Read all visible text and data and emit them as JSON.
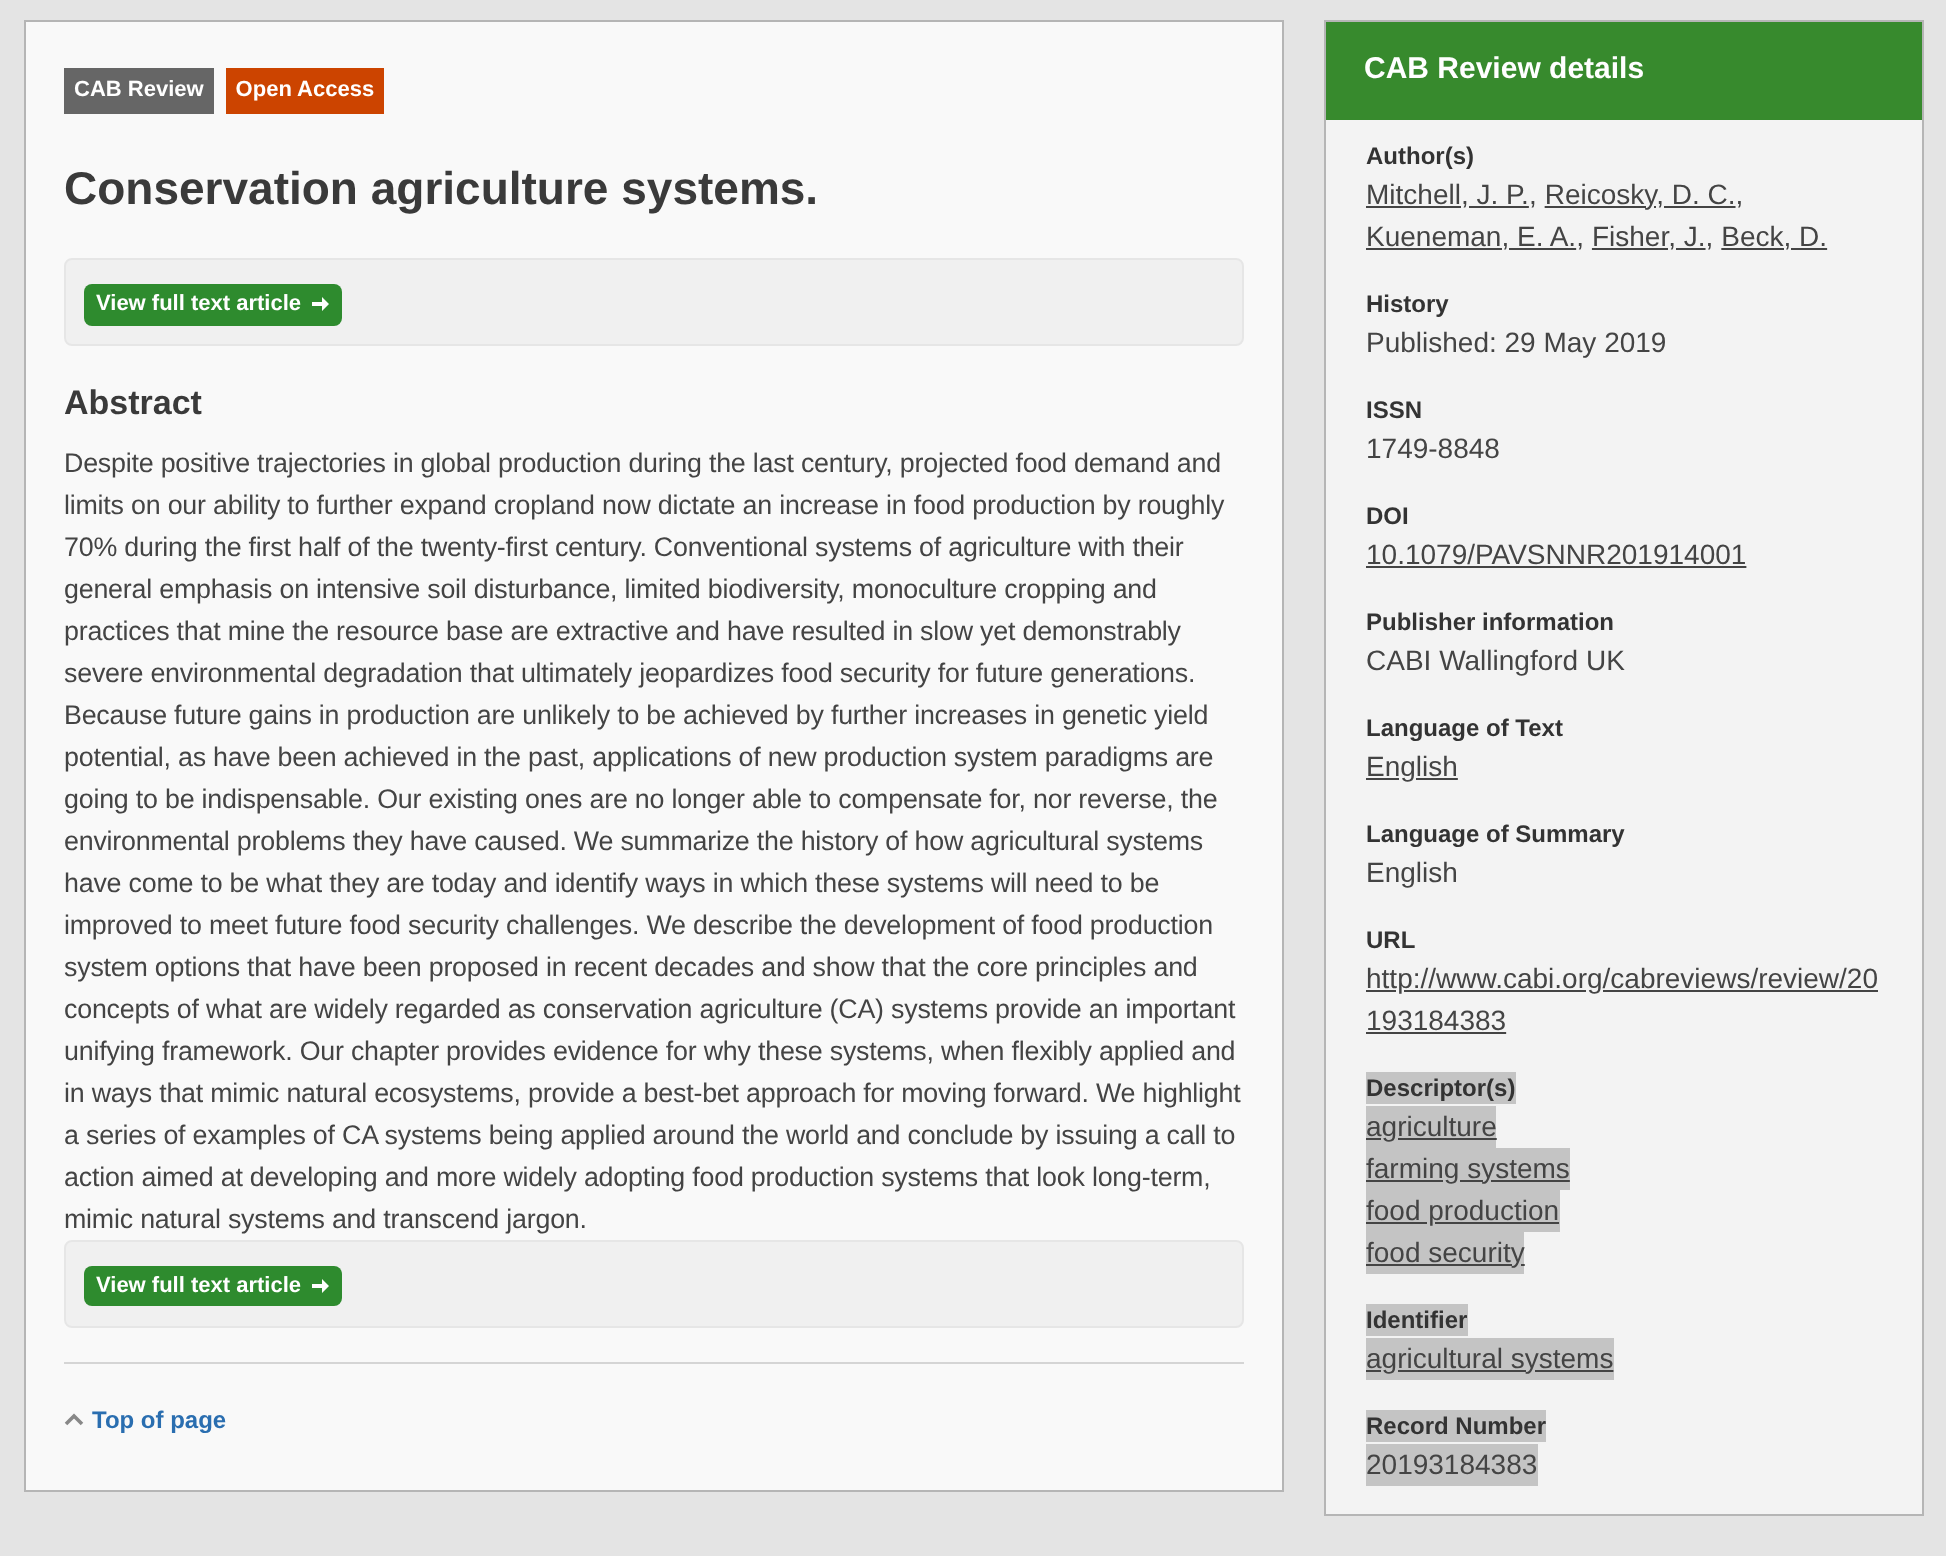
{
  "article": {
    "badges": [
      {
        "text": "CAB Review",
        "color": "#666666"
      },
      {
        "text": "Open Access",
        "color": "#cc4400"
      }
    ],
    "title": "Conservation agriculture systems.",
    "full_text_button_top": "View full text article",
    "abstract_heading": "Abstract",
    "abstract": "Despite positive trajectories in global production during the last century, projected food demand and limits on our ability to further expand cropland now dictate an increase in food production by roughly 70% during the first half of the twenty-first century. Conventional systems of agriculture with their general emphasis on intensive soil disturbance, limited biodiversity, monoculture cropping and practices that mine the resource base are extractive and have resulted in slow yet demonstrably severe environmental degradation that ultimately jeopardizes food security for future generations. Because future gains in production are unlikely to be achieved by further increases in genetic yield potential, as have been achieved in the past, applications of new production system paradigms are going to be indispensable. Our existing ones are no longer able to compensate for, nor reverse, the environmental problems they have caused. We summarize the history of how agricultural systems have come to be what they are today and identify ways in which these systems will need to be improved to meet future food security challenges. We describe the development of food production system options that have been proposed in recent decades and show that the core principles and concepts of what are widely regarded as conservation agriculture (CA) systems provide an important unifying framework. Our chapter provides evidence for why these systems, when flexibly applied and in ways that mimic natural ecosystems, provide a best-bet approach for moving forward. We highlight a series of examples of CA systems being applied around the world and conclude by issuing a call to action aimed at developing and more widely adopting food production systems that look long-term, mimic natural systems and transcend jargon.",
    "full_text_button_bottom": "View full text article",
    "top_link": "Top of page"
  },
  "details": {
    "title": "CAB Review details",
    "fields": [
      {
        "label": "Author(s)",
        "kind": "inline",
        "highlighted": false,
        "values": [
          {
            "text": "Mitchell, J. P.",
            "suffix": ",",
            "link": true,
            "highlighted": false
          },
          {
            "text": "Reicosky, D. C.",
            "suffix": ",",
            "link": true,
            "highlighted": false
          },
          {
            "text": "Kueneman, E. A.",
            "suffix": ",",
            "link": true,
            "highlighted": false
          },
          {
            "text": "Fisher, J.",
            "suffix": ",",
            "link": true,
            "highlighted": false
          },
          {
            "text": "Beck, D.",
            "link": true,
            "highlighted": false
          }
        ]
      },
      {
        "label": "History",
        "kind": "list",
        "highlighted": false,
        "values": [
          {
            "text": "Published: 29 May 2019",
            "link": false,
            "highlighted": false
          }
        ]
      },
      {
        "label": "ISSN",
        "kind": "list",
        "highlighted": false,
        "values": [
          {
            "text": "1749-8848",
            "link": false,
            "highlighted": false
          }
        ]
      },
      {
        "label": "DOI",
        "kind": "list",
        "highlighted": false,
        "values": [
          {
            "text": "10.1079/PAVSNNR201914001",
            "link": true,
            "highlighted": false
          }
        ]
      },
      {
        "label": "Publisher information",
        "kind": "list",
        "highlighted": false,
        "values": [
          {
            "text": "CABI Wallingford UK",
            "link": false,
            "highlighted": false
          }
        ]
      },
      {
        "label": "Language of Text",
        "kind": "list",
        "highlighted": false,
        "values": [
          {
            "text": "English",
            "link": true,
            "highlighted": false
          }
        ]
      },
      {
        "label": "Language of Summary",
        "kind": "list",
        "highlighted": false,
        "values": [
          {
            "text": "English",
            "link": false,
            "highlighted": false
          }
        ]
      },
      {
        "label": "URL",
        "kind": "list",
        "highlighted": false,
        "values": [
          {
            "text": "http://www.cabi.org/cabreviews/review/20193184383",
            "link": true,
            "highlighted": false
          }
        ]
      },
      {
        "label": "Descriptor(s)",
        "kind": "list",
        "highlighted": true,
        "values": [
          {
            "text": "agriculture",
            "link": true,
            "highlighted": true
          },
          {
            "text": "farming systems",
            "link": true,
            "highlighted": true
          },
          {
            "text": "food production",
            "link": true,
            "highlighted": true
          },
          {
            "text": "food security",
            "link": true,
            "highlighted": true
          }
        ]
      },
      {
        "label": "Identifier",
        "kind": "list",
        "highlighted": true,
        "values": [
          {
            "text": "agricultural systems",
            "link": true,
            "highlighted": true
          }
        ]
      },
      {
        "label": "Record Number",
        "kind": "list",
        "highlighted": true,
        "values": [
          {
            "text": "20193184383",
            "link": false,
            "highlighted": true
          }
        ]
      }
    ]
  }
}
